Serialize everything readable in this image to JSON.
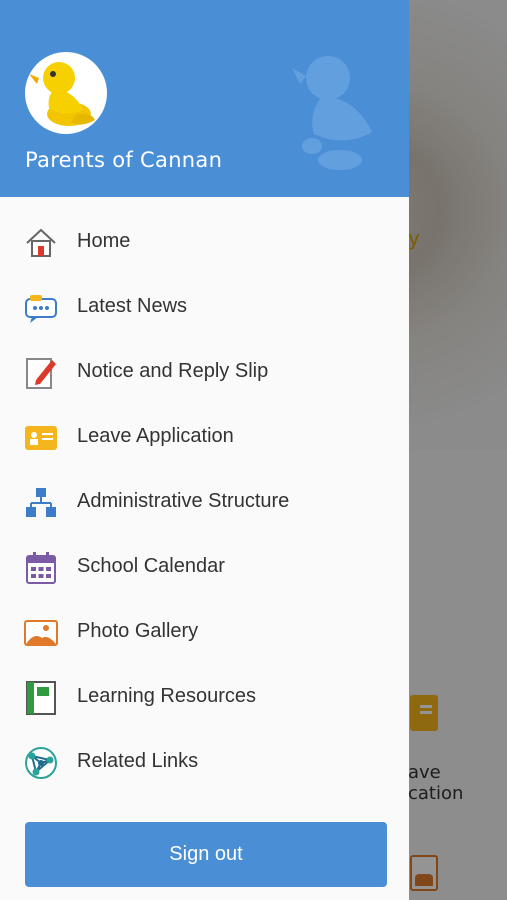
{
  "header": {
    "title": "Parents of Cannan",
    "accent_color": "#4a8fd6"
  },
  "menu": {
    "items": [
      {
        "label": "Home",
        "icon": "home-icon"
      },
      {
        "label": "Latest News",
        "icon": "news-icon"
      },
      {
        "label": "Notice and Reply Slip",
        "icon": "notice-icon"
      },
      {
        "label": "Leave Application",
        "icon": "leave-icon"
      },
      {
        "label": "Administrative Structure",
        "icon": "structure-icon"
      },
      {
        "label": "School Calendar",
        "icon": "calendar-icon"
      },
      {
        "label": "Photo Gallery",
        "icon": "gallery-icon"
      },
      {
        "label": "Learning Resources",
        "icon": "resources-icon"
      },
      {
        "label": "Related Links",
        "icon": "links-icon"
      }
    ]
  },
  "signout": {
    "label": "Sign out"
  },
  "background": {
    "visible_text": "y",
    "leave_label_line1": "ave",
    "leave_label_line2": "cation"
  }
}
